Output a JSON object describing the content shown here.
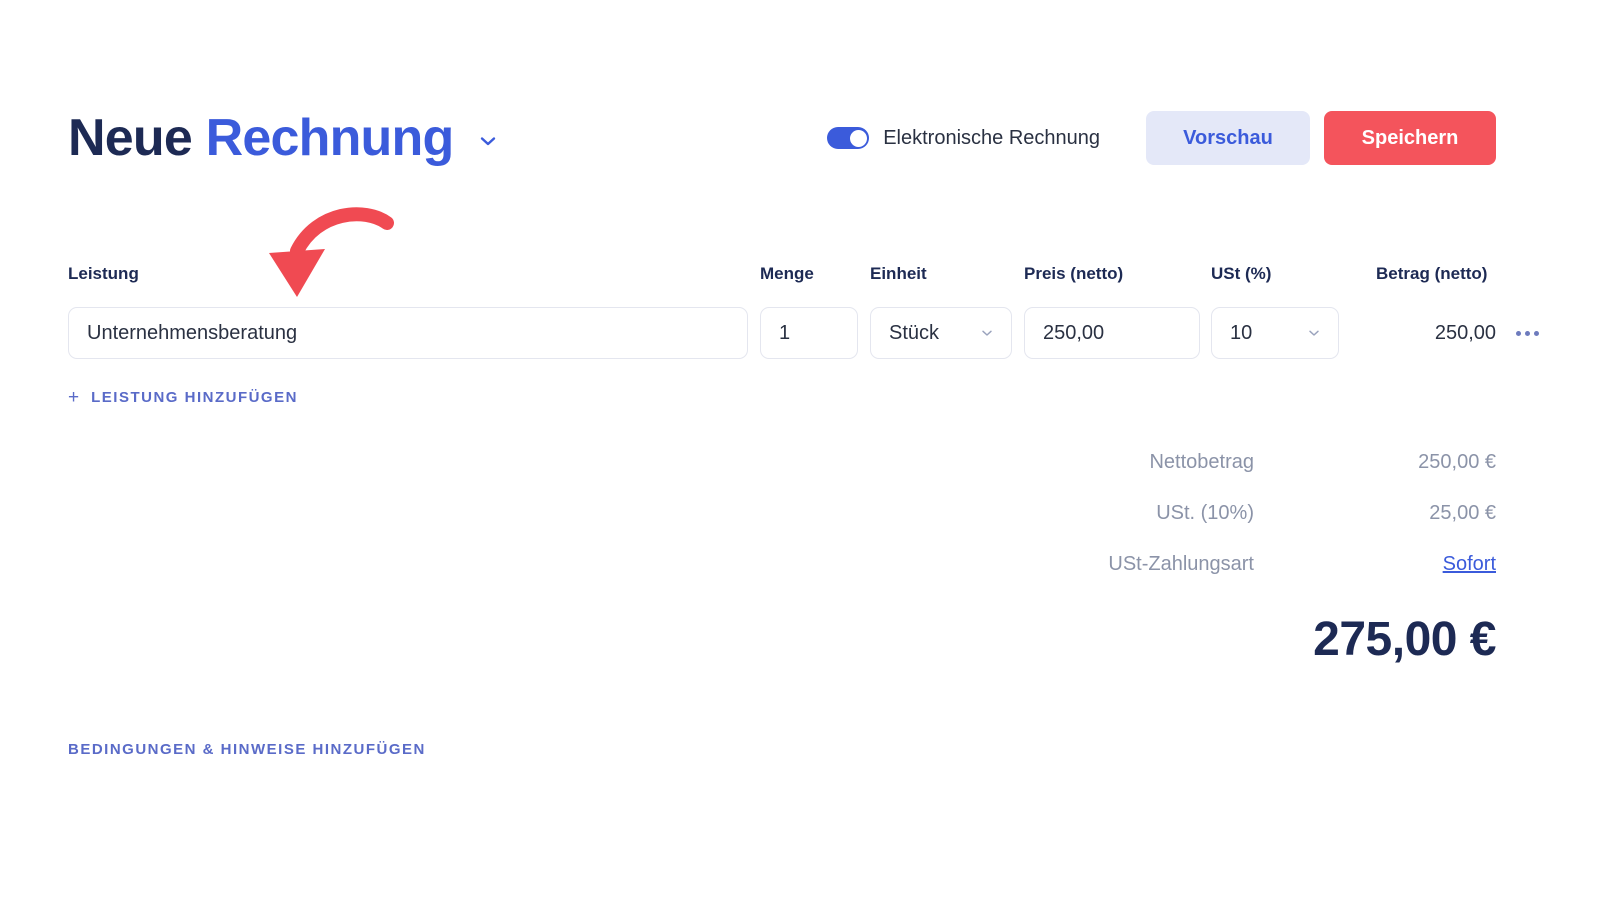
{
  "header": {
    "title_part1": "Neue",
    "title_part2": "Rechnung",
    "title_chevron_icon": "chevron-down-icon",
    "toggle_label": "Elektronische Rechnung",
    "toggle_state": "on",
    "preview_button": "Vorschau",
    "save_button": "Speichern"
  },
  "annotation": {
    "arrow_icon": "curved-arrow-down-left-icon",
    "arrow_color": "#f04a52"
  },
  "items_table": {
    "columns": {
      "description": "Leistung",
      "quantity": "Menge",
      "unit": "Einheit",
      "price": "Preis (netto)",
      "vat": "USt (%)",
      "amount": "Betrag (netto)"
    },
    "rows": [
      {
        "description": "Unternehmensberatung",
        "quantity": "1",
        "unit": "Stück",
        "price": "250,00",
        "vat": "10",
        "amount": "250,00",
        "menu_icon": "ellipsis-horizontal-icon"
      }
    ],
    "add_line_plus": "+",
    "add_line_label": "LEISTUNG HINZUFÜGEN"
  },
  "totals": {
    "rows": [
      {
        "label": "Nettobetrag",
        "value": "250,00 €",
        "is_link": false
      },
      {
        "label": "USt. (10%)",
        "value": "25,00 €",
        "is_link": false
      },
      {
        "label": "USt-Zahlungsart",
        "value": "Sofort",
        "is_link": true
      }
    ],
    "grand_total": "275,00 €"
  },
  "footer": {
    "terms_link": "BEDINGUNGEN & HINWEISE HINZUFÜGEN"
  },
  "colors": {
    "brand_blue": "#3b5bdb",
    "navy": "#1d2a54",
    "accent_red": "#f4545c",
    "muted": "#8b93a8",
    "link_violet": "#5a6bc8",
    "border": "#e4e6ef"
  }
}
